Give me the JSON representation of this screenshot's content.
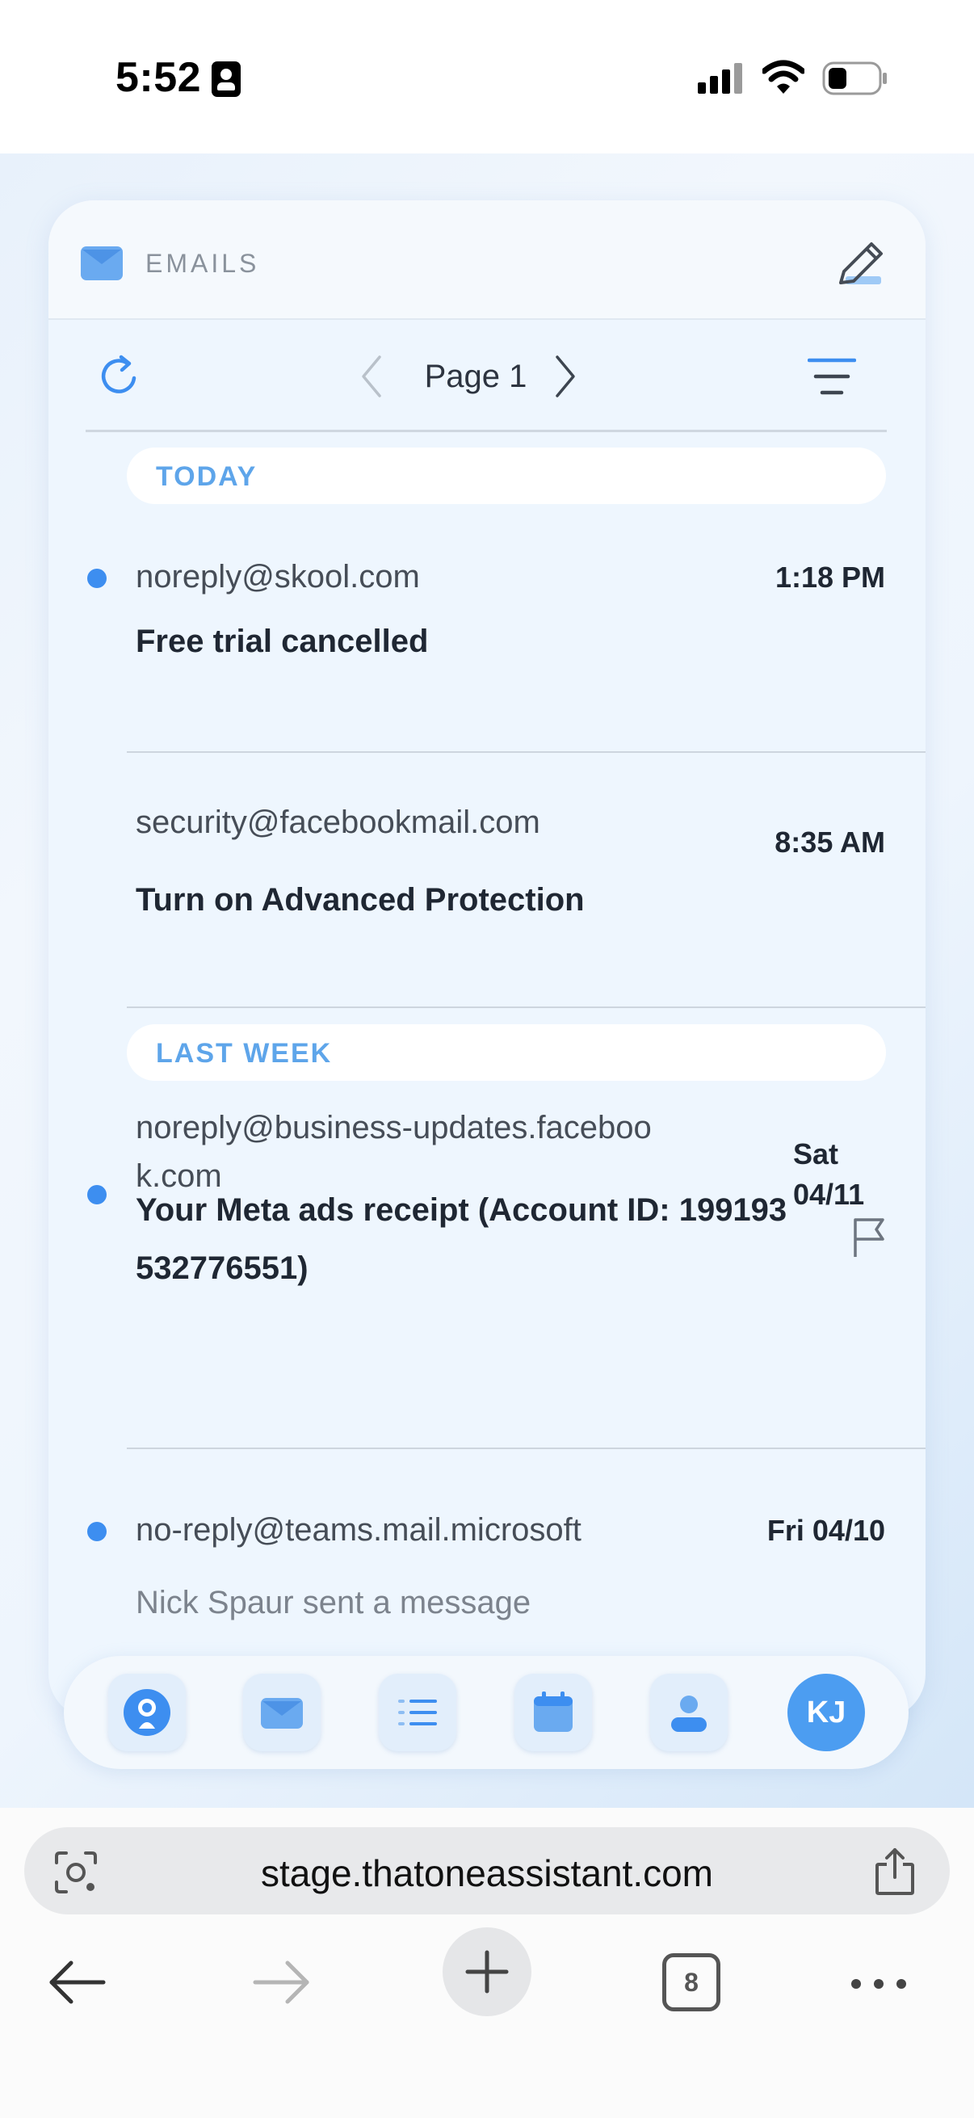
{
  "status_bar": {
    "time": "5:52"
  },
  "header": {
    "title": "EMAILS"
  },
  "toolbar": {
    "page_label": "Page 1"
  },
  "sections": [
    {
      "label": "TODAY"
    },
    {
      "label": "LAST WEEK"
    }
  ],
  "emails": [
    {
      "sender": "noreply@skool.com",
      "time": "1:18 PM",
      "subject": "Free trial cancelled",
      "unread": true
    },
    {
      "sender": "security@facebookmail.com",
      "time": "8:35 AM",
      "subject": "Turn on Advanced Protection",
      "unread": false
    },
    {
      "sender_line1": "noreply@business-updates.faceboo",
      "sender_line2": "k.com",
      "time_line1": "Sat",
      "time_line2": "04/11",
      "subject_line1": "Your Meta ads receipt (Account ID: 199193",
      "subject_line2": "532776551)",
      "unread": true,
      "flag_icon": "flag-icon"
    },
    {
      "sender": "no-reply@teams.mail.microsoft",
      "time": "Fri 04/10",
      "preview": "Nick Spaur sent a message",
      "unread": true
    }
  ],
  "bottom_nav": {
    "items": [
      "assistant-icon",
      "mail-icon",
      "list-icon",
      "calendar-icon",
      "contacts-icon"
    ],
    "avatar_initials": "KJ"
  },
  "browser": {
    "url": "stage.thatoneassistant.com",
    "tab_count": "8"
  },
  "colors": {
    "accent": "#4c9df1",
    "unread_dot": "#3d8ef0",
    "section_label": "#5ea5ea"
  }
}
